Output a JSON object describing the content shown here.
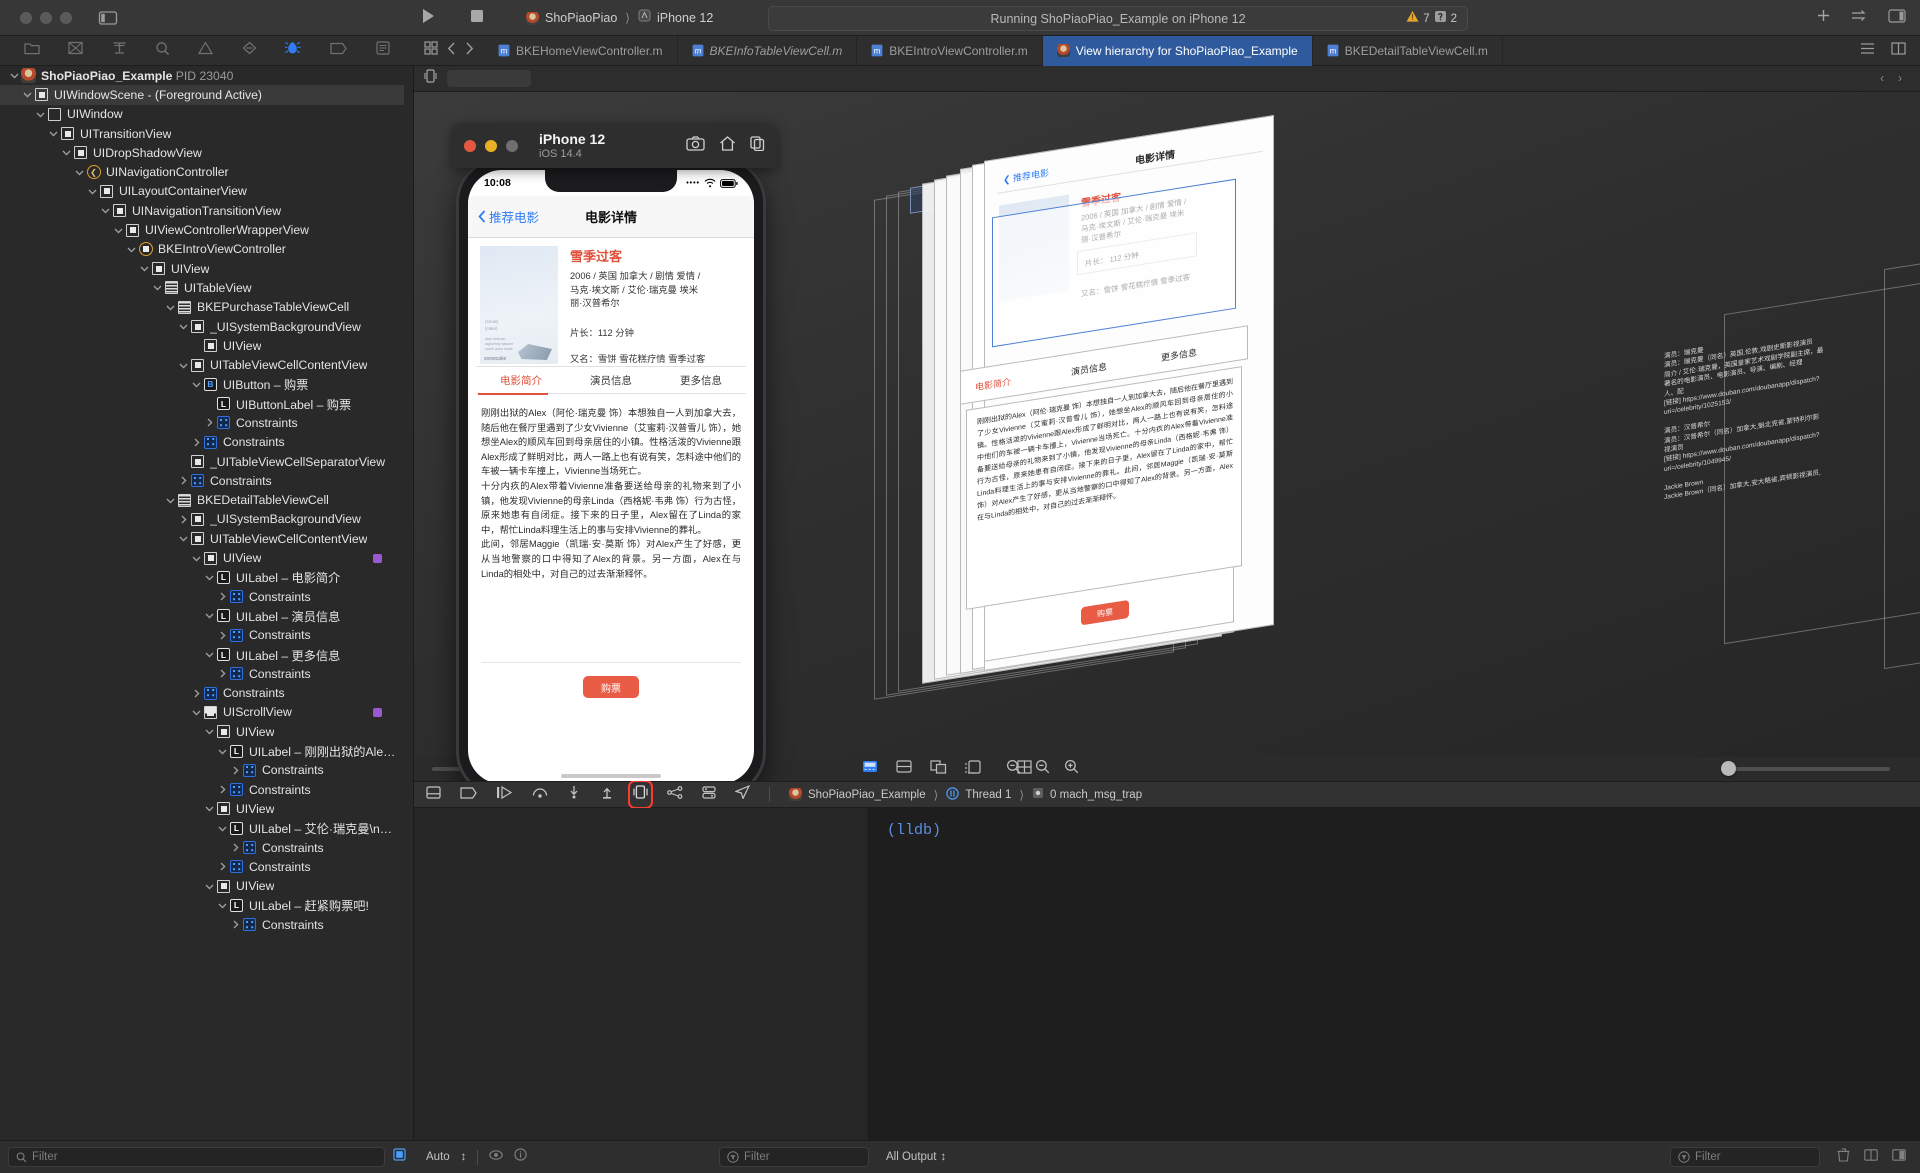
{
  "window": {
    "traffic_lights": [
      "close",
      "minimize",
      "zoom"
    ],
    "sidebar_toggle": "sidebar-toggle-icon"
  },
  "toolbar": {
    "run_label": "run-icon",
    "stop_label": "stop-icon",
    "scheme": "ShoPiaoPiao",
    "destination": "iPhone 12",
    "status_text": "Running ShoPiaoPiao_Example on iPhone 12",
    "warning_count": "7",
    "note_count": "2"
  },
  "navigator_toolbar": {
    "icons": [
      "folder-icon",
      "source-control-icon",
      "symbol-icon",
      "search-icon",
      "issue-icon",
      "test-icon",
      "debug-icon",
      "breakpoint-icon",
      "report-icon"
    ],
    "selected": "debug-icon"
  },
  "editor_tabs": {
    "items": [
      {
        "label": "BKEHomeViewController.m",
        "icon": "m-file-icon",
        "active": false,
        "italic": false
      },
      {
        "label": "BKEInfoTableViewCell.m",
        "icon": "m-file-icon",
        "active": false,
        "italic": true
      },
      {
        "label": "BKEIntroViewController.m",
        "icon": "m-file-icon",
        "active": false,
        "italic": false
      },
      {
        "label": "View hierarchy for ShoPiaoPiao_Example",
        "icon": "app-icon",
        "active": true,
        "italic": false
      },
      {
        "label": "BKEDetailTableViewCell.m",
        "icon": "m-file-icon",
        "active": false,
        "italic": false
      }
    ]
  },
  "navigator": {
    "filter_placeholder": "Filter",
    "tree": [
      {
        "depth": 0,
        "tw": "down",
        "icon": "app-icon",
        "label": "ShoPiaoPiao_Example",
        "dim": " PID 23040",
        "sel": false,
        "bold": true
      },
      {
        "depth": 1,
        "tw": "down",
        "icon": "view-icon",
        "label": "UIWindowScene - (Foreground Active)",
        "sel": true
      },
      {
        "depth": 2,
        "tw": "down",
        "icon": "empty-view-icon",
        "label": "UIWindow",
        "sel": false
      },
      {
        "depth": 3,
        "tw": "down",
        "icon": "view-icon",
        "label": "UITransitionView",
        "sel": false
      },
      {
        "depth": 4,
        "tw": "down",
        "icon": "view-icon",
        "label": "UIDropShadowView",
        "sel": false
      },
      {
        "depth": 5,
        "tw": "down",
        "icon": "nav-vc-icon",
        "label": "UINavigationController",
        "sel": false
      },
      {
        "depth": 6,
        "tw": "down",
        "icon": "view-icon",
        "label": "UILayoutContainerView",
        "sel": false
      },
      {
        "depth": 7,
        "tw": "down",
        "icon": "view-icon",
        "label": "UINavigationTransitionView",
        "sel": false
      },
      {
        "depth": 8,
        "tw": "down",
        "icon": "view-icon",
        "label": "UIViewControllerWrapperView",
        "sel": false
      },
      {
        "depth": 9,
        "tw": "down",
        "icon": "vc-icon",
        "label": "BKEIntroViewController",
        "sel": false
      },
      {
        "depth": 10,
        "tw": "down",
        "icon": "view-icon",
        "label": "UIView",
        "sel": false
      },
      {
        "depth": 11,
        "tw": "down",
        "icon": "tableview-icon",
        "label": "UITableView",
        "sel": false
      },
      {
        "depth": 12,
        "tw": "down",
        "icon": "tableview-icon",
        "label": "BKEPurchaseTableViewCell",
        "sel": false
      },
      {
        "depth": 13,
        "tw": "down",
        "icon": "view-icon",
        "label": "_UISystemBackgroundView",
        "sel": false
      },
      {
        "depth": 14,
        "tw": "none",
        "icon": "view-icon",
        "label": "UIView",
        "sel": false
      },
      {
        "depth": 13,
        "tw": "down",
        "icon": "view-icon",
        "label": "UITableViewCellContentView",
        "sel": false
      },
      {
        "depth": 14,
        "tw": "down",
        "icon": "button-icon",
        "label": "UIButton – 购票",
        "sel": false
      },
      {
        "depth": 15,
        "tw": "none",
        "icon": "label-icon",
        "label": "UIButtonLabel – 购票",
        "sel": false
      },
      {
        "depth": 15,
        "tw": "right",
        "icon": "constraints-icon",
        "label": "Constraints",
        "sel": false
      },
      {
        "depth": 14,
        "tw": "right",
        "icon": "constraints-icon",
        "label": "Constraints",
        "sel": false
      },
      {
        "depth": 13,
        "tw": "none",
        "icon": "view-icon",
        "label": "_UITableViewCellSeparatorView",
        "sel": false
      },
      {
        "depth": 13,
        "tw": "right",
        "icon": "constraints-icon",
        "label": "Constraints",
        "sel": false
      },
      {
        "depth": 12,
        "tw": "down",
        "icon": "tableview-icon",
        "label": "BKEDetailTableViewCell",
        "sel": false
      },
      {
        "depth": 13,
        "tw": "right",
        "icon": "view-icon",
        "label": "_UISystemBackgroundView",
        "sel": false
      },
      {
        "depth": 13,
        "tw": "down",
        "icon": "view-icon",
        "label": "UITableViewCellContentView",
        "sel": false
      },
      {
        "depth": 14,
        "tw": "down",
        "icon": "view-icon",
        "label": "UIView",
        "sel": false,
        "dot": true
      },
      {
        "depth": 15,
        "tw": "down",
        "icon": "label-icon",
        "label": "UILabel – 电影简介",
        "sel": false
      },
      {
        "depth": 16,
        "tw": "right",
        "icon": "constraints-icon",
        "label": "Constraints",
        "sel": false
      },
      {
        "depth": 15,
        "tw": "down",
        "icon": "label-icon",
        "label": "UILabel – 演员信息",
        "sel": false
      },
      {
        "depth": 16,
        "tw": "right",
        "icon": "constraints-icon",
        "label": "Constraints",
        "sel": false
      },
      {
        "depth": 15,
        "tw": "down",
        "icon": "label-icon",
        "label": "UILabel – 更多信息",
        "sel": false
      },
      {
        "depth": 16,
        "tw": "right",
        "icon": "constraints-icon",
        "label": "Constraints",
        "sel": false
      },
      {
        "depth": 14,
        "tw": "right",
        "icon": "constraints-icon",
        "label": "Constraints",
        "sel": false
      },
      {
        "depth": 14,
        "tw": "down",
        "icon": "scrollview-icon",
        "label": "UIScrollView",
        "sel": false,
        "dot": true
      },
      {
        "depth": 15,
        "tw": "down",
        "icon": "view-icon",
        "label": "UIView",
        "sel": false
      },
      {
        "depth": 16,
        "tw": "down",
        "icon": "label-icon",
        "label": "UILabel – 刚刚出狱的Ale…",
        "sel": false
      },
      {
        "depth": 17,
        "tw": "right",
        "icon": "constraints-icon",
        "label": "Constraints",
        "sel": false
      },
      {
        "depth": 16,
        "tw": "right",
        "icon": "constraints-icon",
        "label": "Constraints",
        "sel": false
      },
      {
        "depth": 15,
        "tw": "down",
        "icon": "view-icon",
        "label": "UIView",
        "sel": false
      },
      {
        "depth": 16,
        "tw": "down",
        "icon": "label-icon",
        "label": "UILabel – 艾伦·瑞克曼\\n…",
        "sel": false
      },
      {
        "depth": 17,
        "tw": "right",
        "icon": "constraints-icon",
        "label": "Constraints",
        "sel": false
      },
      {
        "depth": 16,
        "tw": "right",
        "icon": "constraints-icon",
        "label": "Constraints",
        "sel": false
      },
      {
        "depth": 15,
        "tw": "down",
        "icon": "view-icon",
        "label": "UIView",
        "sel": false
      },
      {
        "depth": 16,
        "tw": "down",
        "icon": "label-icon",
        "label": "UILabel – 赶紧购票吧!",
        "sel": false
      },
      {
        "depth": 17,
        "tw": "right",
        "icon": "constraints-icon",
        "label": "Constraints",
        "sel": false
      }
    ]
  },
  "simulator": {
    "title": "iPhone 12",
    "os": "iOS 14.4",
    "window_icons": [
      "screenshot-icon",
      "home-icon",
      "copy-icon"
    ],
    "status_time": "10:08",
    "nav_back": "推荐电影",
    "nav_title": "电影详情",
    "movie": {
      "title": "雪季过客",
      "meta": "2006 / 英国 加拿大 / 剧情 爱情 /\n马克·埃文斯 / 艾伦·瑞克曼 埃米\n丽·汉普希尔",
      "length": "片长：112 分钟",
      "alias": "又名：雪饼 雪花糕疗情 雪季过客",
      "poster_cast": "alan rickman\nsigourney weaver\ncarrie anne moss",
      "segments": [
        "电影简介",
        "演员信息",
        "更多信息"
      ],
      "segment_active": "电影简介",
      "body": "刚刚出狱的Alex（阿伦·瑞克曼 饰）本想独自一人到加拿大去，随后他在餐厅里遇到了少女Vivienne（艾蜜莉·汉普雪儿 饰），她想坐Alex的顺风车回到母亲居住的小镇。性格活泼的Vivienne跟Alex形成了鲜明对比，两人一路上也有说有笑，怎料途中他们的车被一辆卡车撞上，Vivienne当场死亡。\n十分内疚的Alex带着Vivienne准备要送给母亲的礼物来到了小镇，他发现Vivienne的母亲Linda（西格妮·韦弗 饰）行为古怪，原来她患有自闭症。接下来的日子里，Alex留在了Linda的家中，帮忙Linda料理生活上的事与安排Vivienne的葬礼。\n此间，邻居Maggie（凯瑞·安·莫斯 饰）对Alex产生了好感，更从当地警察的口中得知了Alex的背景。另一方面，Alex在与Linda的相处中，对自己的过去渐渐释怀。",
      "buy_button": "购票"
    }
  },
  "canvas_toolbar": {
    "left_slider_label": "view-spacing-slider",
    "icons": [
      "show-clipped-icon",
      "show-constraints-icon",
      "orient-double-icon",
      "grid-icon",
      "zoom-out-icon",
      "zoom-fit-icon",
      "zoom-in-icon"
    ],
    "right_slider_label": "view-range-slider"
  },
  "debug_bar": {
    "icons": [
      "hide-debug-area-icon",
      "breakpoints-icon",
      "continue-icon",
      "step-over-icon",
      "step-into-icon",
      "step-out-icon",
      "view-debug-icon",
      "memory-graph-icon",
      "simulate-location-icon",
      "environment-overrides-icon"
    ],
    "highlighted_icon": "view-debug-icon",
    "process": "ShoPiaoPiao_Example",
    "thread": "Thread 1",
    "frame": "0 mach_msg_trap"
  },
  "console": {
    "prompt": "(lldb)"
  },
  "bottom_bar": {
    "scope": "Auto",
    "variables_filter_placeholder": "Filter",
    "output_scope": "All Output",
    "console_filter_placeholder": "Filter"
  }
}
